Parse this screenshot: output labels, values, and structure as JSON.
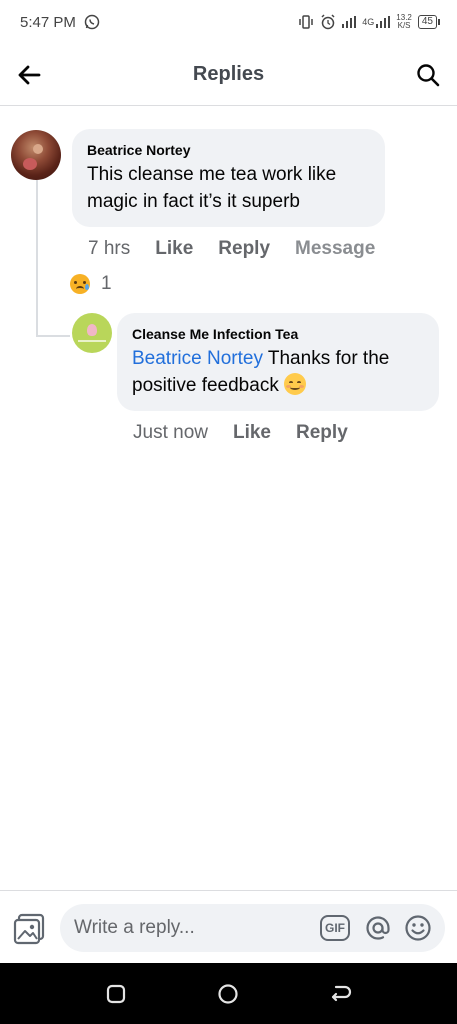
{
  "status_bar": {
    "time": "5:47 PM",
    "net_type": "4G",
    "net_speed_value": "13.2",
    "net_speed_unit": "K/S",
    "battery": "45"
  },
  "header": {
    "title": "Replies",
    "back_icon": "arrow-left-icon",
    "search_icon": "search-icon"
  },
  "comments": [
    {
      "author": "Beatrice Nortey",
      "text": "This cleanse me tea work like magic in fact it’s it superb",
      "time": "7 hrs",
      "actions": [
        "Like",
        "Reply",
        "Message"
      ],
      "reaction_emoji": "sad-tear-emoji-icon",
      "reaction_count": "1"
    },
    {
      "author": "Cleanse Me Infection Tea",
      "mention": "Beatrice Nortey",
      "text": " Thanks for the positive feedback ",
      "emoji": "smiling-face-icon",
      "time": "Just now",
      "actions": [
        "Like",
        "Reply"
      ]
    }
  ],
  "composer": {
    "placeholder": "Write a reply...",
    "gif_label": "GIF",
    "photo_icon": "photo-icon",
    "at_icon": "at-sign-icon",
    "emoji_icon": "smiley-icon"
  },
  "nav_bar": {
    "items": [
      "recent-apps-icon",
      "home-icon",
      "back-icon"
    ]
  },
  "colors": {
    "link": "#216fdb",
    "bubble": "#f0f2f5",
    "secondary_text": "#65676b"
  }
}
